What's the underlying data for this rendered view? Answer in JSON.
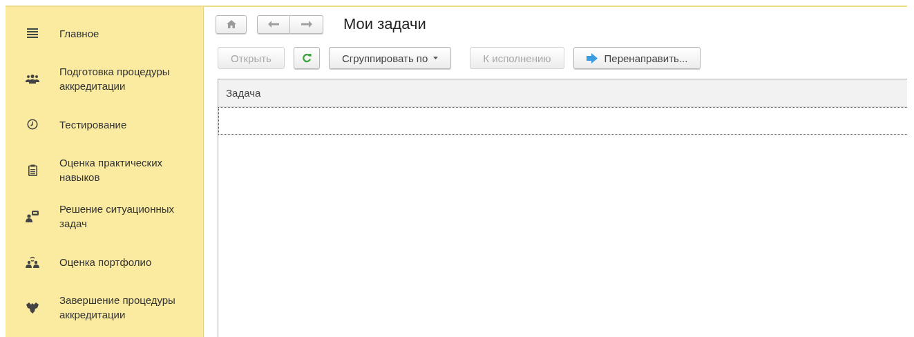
{
  "sidebar": {
    "items": [
      {
        "label": "Главное"
      },
      {
        "label": "Подготовка процедуры аккредитации"
      },
      {
        "label": "Тестирование"
      },
      {
        "label": "Оценка практических навыков"
      },
      {
        "label": "Решение ситуационных задач"
      },
      {
        "label": "Оценка портфолио"
      },
      {
        "label": "Завершение процедуры аккредитации"
      }
    ]
  },
  "title": "Мои задачи",
  "toolbar": [
    {
      "kind": "text",
      "label": "Открыть",
      "disabled": true
    },
    {
      "kind": "refresh",
      "disabled": false
    },
    {
      "kind": "menu",
      "label": "Сгруппировать по",
      "disabled": false
    },
    {
      "kind": "text",
      "label": "К исполнению",
      "disabled": true
    },
    {
      "kind": "forward",
      "label": "Перенаправить...",
      "disabled": false
    }
  ],
  "table": {
    "columns": [
      "Задача"
    ]
  }
}
